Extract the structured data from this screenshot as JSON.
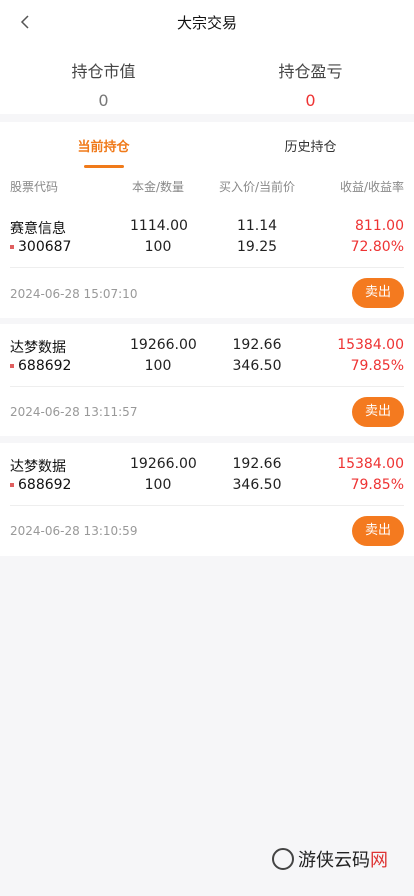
{
  "header": {
    "title": "大宗交易",
    "back_icon": "chevron-left-icon"
  },
  "summary": {
    "market_value_label": "持仓市值",
    "market_value": "0",
    "profit_loss_label": "持仓盈亏",
    "profit_loss": "0"
  },
  "tabs": [
    {
      "label": "当前持仓",
      "active": true
    },
    {
      "label": "历史持仓",
      "active": false
    }
  ],
  "columns": [
    "股票代码",
    "本金/数量",
    "买入价/当前价",
    "收益/收益率"
  ],
  "positions": [
    {
      "name": "赛意信息",
      "code": "300687",
      "principal": "1114.00",
      "quantity": "100",
      "buy_price": "11.14",
      "current_price": "19.25",
      "profit": "811.00",
      "profit_rate": "72.80%",
      "time": "2024-06-28 15:07:10",
      "sell_label": "卖出"
    },
    {
      "name": "达梦数据",
      "code": "688692",
      "principal": "19266.00",
      "quantity": "100",
      "buy_price": "192.66",
      "current_price": "346.50",
      "profit": "15384.00",
      "profit_rate": "79.85%",
      "time": "2024-06-28 13:11:57",
      "sell_label": "卖出"
    },
    {
      "name": "达梦数据",
      "code": "688692",
      "principal": "19266.00",
      "quantity": "100",
      "buy_price": "192.66",
      "current_price": "346.50",
      "profit": "15384.00",
      "profit_rate": "79.85%",
      "time": "2024-06-28 13:10:59",
      "sell_label": "卖出"
    }
  ],
  "watermark": {
    "text_black": "游侠云码",
    "text_red": "网"
  },
  "colors": {
    "accent": "#f47a1f",
    "profit_red": "#e33333"
  }
}
